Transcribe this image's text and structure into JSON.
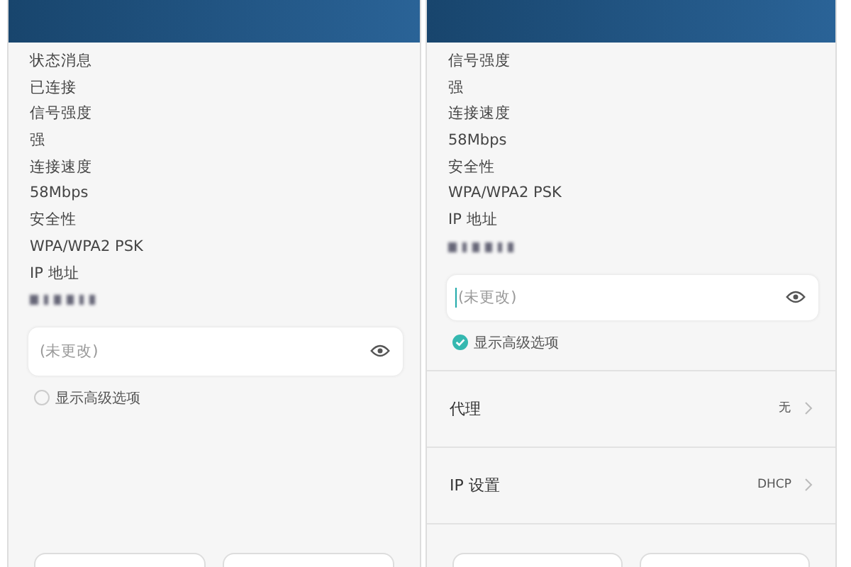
{
  "panels": [
    {
      "info": [
        {
          "kind": "text",
          "text": "状态消息"
        },
        {
          "kind": "text",
          "text": "已连接"
        },
        {
          "kind": "text",
          "text": "信号强度"
        },
        {
          "kind": "text",
          "text": "强"
        },
        {
          "kind": "text",
          "text": "连接速度"
        },
        {
          "kind": "text",
          "text": "58Mbps"
        },
        {
          "kind": "text",
          "text": "安全性"
        },
        {
          "kind": "text",
          "text": "WPA/WPA2 PSK"
        },
        {
          "kind": "text",
          "text": "IP 地址"
        },
        {
          "kind": "redacted"
        }
      ],
      "password": {
        "placeholder": "(未更改)",
        "focused": false
      },
      "advanced": {
        "label": "显示高级选项",
        "checked": false
      },
      "buttons": [
        {
          "kind": "button"
        },
        {
          "kind": "button"
        }
      ]
    },
    {
      "info": [
        {
          "kind": "text",
          "text": "信号强度"
        },
        {
          "kind": "text",
          "text": "强"
        },
        {
          "kind": "text",
          "text": "连接速度"
        },
        {
          "kind": "text",
          "text": "58Mbps"
        },
        {
          "kind": "text",
          "text": "安全性"
        },
        {
          "kind": "text",
          "text": "WPA/WPA2 PSK"
        },
        {
          "kind": "text",
          "text": "IP 地址"
        },
        {
          "kind": "redacted"
        }
      ],
      "password": {
        "placeholder": "(未更改)",
        "focused": true
      },
      "advanced": {
        "label": "显示高级选项",
        "checked": true
      },
      "settings": [
        {
          "label": "代理",
          "value": "无"
        },
        {
          "label": "IP 设置",
          "value": "DHCP"
        }
      ],
      "buttons": [
        {
          "kind": "button"
        },
        {
          "kind": "button"
        }
      ]
    }
  ]
}
